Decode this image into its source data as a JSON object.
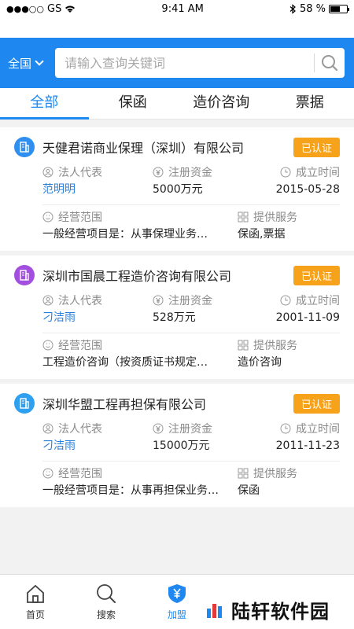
{
  "status_bar": {
    "carrier": "GS",
    "time": "9:41 AM",
    "battery": "58 %",
    "battery_level": 0.58
  },
  "header": {
    "region": "全国",
    "search_placeholder": "请输入查询关键词"
  },
  "tabs": [
    {
      "label": "全部",
      "active": true
    },
    {
      "label": "保函",
      "active": false
    },
    {
      "label": "造价咨询",
      "active": false
    },
    {
      "label": "票据",
      "active": false
    }
  ],
  "labels": {
    "legal_rep": "法人代表",
    "capital": "注册资金",
    "founded": "成立时间",
    "scope": "经营范围",
    "services": "提供服务"
  },
  "companies": [
    {
      "name": "天健君诺商业保理（深圳）有限公司",
      "badge": "已认证",
      "icon_color": "#2f8ff0",
      "legal_rep": "范明明",
      "capital": "5000万元",
      "founded": "2015-05-28",
      "scope": "一般经营项目是：从事保理业务…",
      "services": "保函,票据"
    },
    {
      "name": "深圳市国晨工程造价咨询有限公司",
      "badge": "已认证",
      "icon_color": "#a24fe0",
      "legal_rep": "刁洁雨",
      "capital": "528万元",
      "founded": "2001-11-09",
      "scope": "工程造价咨询（按资质证书规定…",
      "services": "造价咨询"
    },
    {
      "name": "深圳华盟工程再担保有限公司",
      "badge": "已认证",
      "icon_color": "#2f9ff0",
      "legal_rep": "刁洁雨",
      "capital": "15000万元",
      "founded": "2011-11-23",
      "scope": "一般经营项目是：从事再担保业务…",
      "services": "保函"
    }
  ],
  "tabbar": [
    {
      "label": "首页",
      "icon": "home-icon",
      "active": false
    },
    {
      "label": "搜索",
      "icon": "search-icon",
      "active": false
    },
    {
      "label": "加盟",
      "icon": "shield-yen-icon",
      "active": true
    },
    {
      "label": "",
      "icon": "briefcase-icon",
      "active": false
    },
    {
      "label": "",
      "icon": "user-icon",
      "active": false
    }
  ],
  "watermark": {
    "text": "陆轩软件园"
  },
  "colors": {
    "primary": "#1e88f0",
    "badge": "#f7a21b",
    "link": "#2a7fd8"
  }
}
